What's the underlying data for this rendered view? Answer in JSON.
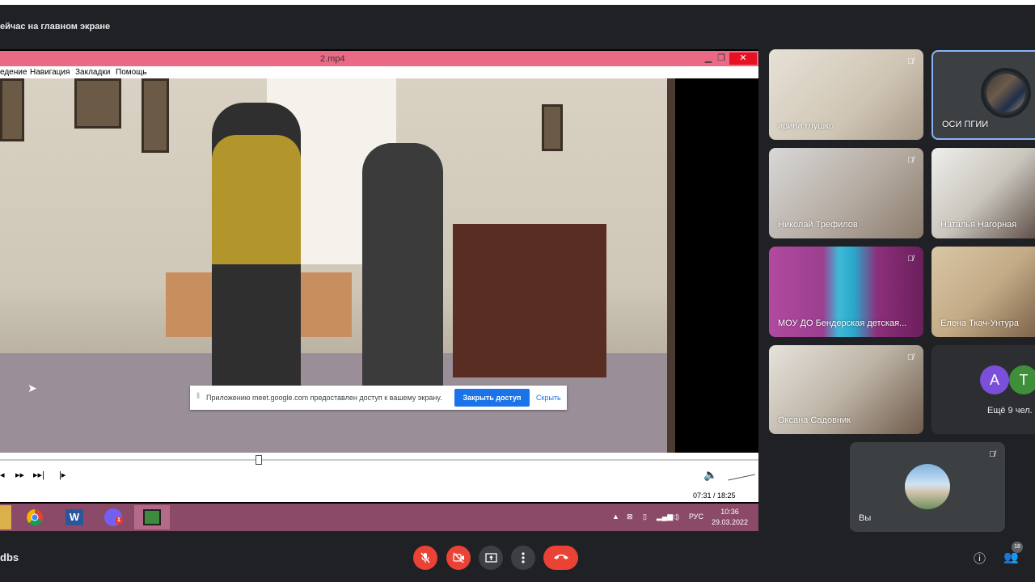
{
  "presentation": {
    "title": "ейчас на главном экране"
  },
  "player": {
    "title": "2.mp4",
    "menu": [
      "едение",
      "Навигация",
      "Закладки",
      "Помощь"
    ],
    "time": "07:31 / 18:25",
    "seek_progress": 0.337
  },
  "share_notice": {
    "text": "Приложению meet.google.com предоставлен доступ к вашему экрану.",
    "stop_label": "Закрыть доступ",
    "hide_label": "Скрыть"
  },
  "taskbar": {
    "lang": "РУС",
    "clock_time": "10:36",
    "clock_date": "29.03.2022",
    "word_letter": "W",
    "viber_badge": "1"
  },
  "participants": [
    {
      "name": "ирина глушко",
      "muted": true
    },
    {
      "name": "ОСИ ПГИИ",
      "muted": false,
      "pinned": true
    },
    {
      "name": "Николай Трефилов",
      "muted": true
    },
    {
      "name": "Наталья Нагорная",
      "muted": false
    },
    {
      "name": "МОУ ДО Бендерская детская...",
      "muted": true
    },
    {
      "name": "Елена Ткач-Унтура",
      "muted": false
    },
    {
      "name": "Оксана Садовник",
      "muted": true
    }
  ],
  "others": {
    "letters": [
      "A",
      "T"
    ],
    "colors": [
      "#7b4fd9",
      "#3f8f3a"
    ],
    "label": "Ещё 9 чел."
  },
  "self": {
    "name": "Вы",
    "muted": true
  },
  "bottom_bar": {
    "meeting_code": "dbs",
    "people_count": "18"
  },
  "colors": {
    "accent_red": "#ea4335",
    "accent_blue": "#1a73e8",
    "tile_bg": "#3c4043"
  }
}
